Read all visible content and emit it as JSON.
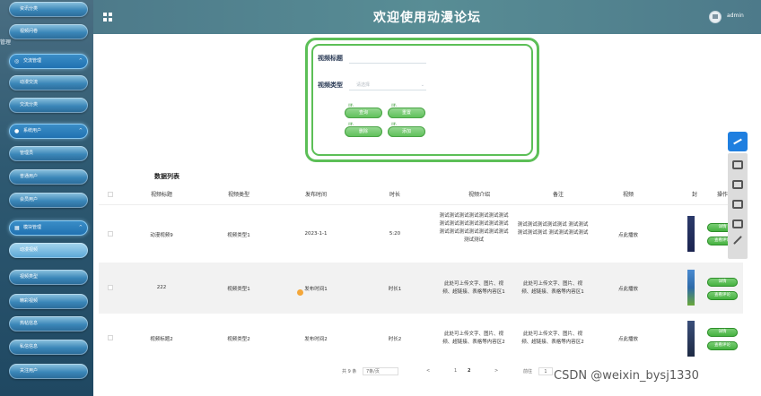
{
  "app": {
    "title": "欢迎使用动漫论坛",
    "user": "admin"
  },
  "sidebar": {
    "top_cut_label": "管理",
    "items": [
      {
        "label": "资讯分类",
        "kind": "item"
      },
      {
        "label": "视频问卷",
        "kind": "item"
      },
      {
        "label": "交流管理",
        "kind": "group",
        "icon": "chat-icon"
      },
      {
        "label": "动漫交流",
        "kind": "item"
      },
      {
        "label": "交流分类",
        "kind": "item"
      },
      {
        "label": "系统用户",
        "kind": "group",
        "icon": "user-icon"
      },
      {
        "label": "管理员",
        "kind": "item"
      },
      {
        "label": "普通用户",
        "kind": "item"
      },
      {
        "label": "会员用户",
        "kind": "item"
      },
      {
        "label": "模块管理",
        "kind": "group",
        "icon": "grid-icon"
      },
      {
        "label": "动漫视频",
        "kind": "item",
        "active": true
      },
      {
        "label": "视频类型",
        "kind": "item"
      },
      {
        "label": "精彩视频",
        "kind": "item"
      },
      {
        "label": "热帖信息",
        "kind": "item"
      },
      {
        "label": "私信信息",
        "kind": "item"
      },
      {
        "label": "关注用户",
        "kind": "item"
      }
    ]
  },
  "search": {
    "title_label": "视频标题",
    "title_value": "",
    "type_label": "视频类型",
    "type_placeholder": "请选择",
    "btn_query": "查询",
    "btn_reset": "重置",
    "btn_delete": "删除",
    "btn_add": "添加"
  },
  "table": {
    "title": "数据列表",
    "columns": [
      "视频标题",
      "视频类型",
      "发布时间",
      "时长",
      "视频介绍",
      "备注",
      "视频",
      "封",
      "操作"
    ],
    "rows": [
      {
        "title": "动漫视频9",
        "type": "视频类型1",
        "time": "2023-1-1",
        "duration": "5:20",
        "intro": "测试测试测试测试测试测试测试测试测试测试测试测试测试测试 测试测试测试测试测试测试测试测试测试",
        "remark": "测试测试测试测试测试 测试测试测试测试测试 测试测试测试测试",
        "video": "点此播放",
        "op1": "详情",
        "op2": "查看评论"
      },
      {
        "title": "222",
        "type": "视频类型1",
        "time": "发布时间1",
        "duration": "时长1",
        "intro": "此处可上传文字、图片、视频、超链接、表格等内容区1",
        "remark": "此处可上传文字、图片、视频、超链接、表格等内容区1",
        "video": "点此播放",
        "op1": "详情",
        "op2": "查看评论"
      },
      {
        "title": "视频标题2",
        "type": "视频类型2",
        "time": "发布时间2",
        "duration": "时长2",
        "intro": "此处可上传文字、图片、视频、超链接、表格等内容区2",
        "remark": "此处可上传文字、图片、视频、超链接、表格等内容区2",
        "video": "点此播放",
        "op1": "详情",
        "op2": "查看评论"
      }
    ]
  },
  "pager": {
    "total": "共 9 条",
    "size": "7条/页",
    "prev": "<",
    "p1": "1",
    "p2": "2",
    "next": ">",
    "goto": "前往",
    "goto_val": "1"
  },
  "watermark": "CSDN @weixin_bysj1330"
}
